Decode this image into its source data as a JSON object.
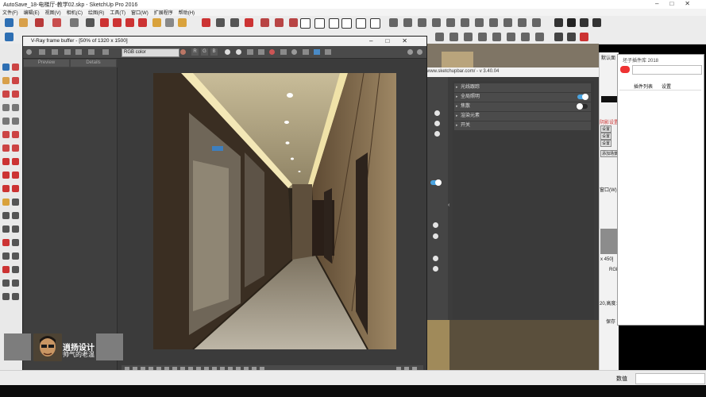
{
  "app": {
    "title": "AutoSave_18-电梯厅-教学02.skp - SketchUp Pro 2016",
    "menu": [
      "文件(F)",
      "编辑(E)",
      "视图(V)",
      "相机(C)",
      "绘图(R)",
      "工具(T)",
      "窗口(W)",
      "扩展程序",
      "帮助(H)"
    ],
    "status_label": "数值"
  },
  "vfb": {
    "title": "V-Ray frame buffer - [50% of 1320 x 1500]",
    "channel": "RGB color",
    "tab_preview": "Preview",
    "tab_details": "Details",
    "channel_letters": [
      "R",
      "G",
      "B"
    ]
  },
  "profile": {
    "name": "逍扬设计",
    "slogan": "帅气的老温"
  },
  "extension": {
    "url": "www.sketchupbar.com/ - v 3.40.04",
    "rows": [
      {
        "label": "光线跟踪",
        "toggle": false
      },
      {
        "label": "全局照明",
        "toggle": true
      },
      {
        "label": "焦散",
        "toggle": false
      },
      {
        "label": "渲染元素",
        "toggle": false
      },
      {
        "label": "开关",
        "toggle": false
      }
    ]
  },
  "plugin": {
    "title": "坯子插件库 2018",
    "tab_list": "插件列表",
    "tab_settings": "设置"
  },
  "tray": {
    "tray_label": "默认面",
    "section_label": "阴影设置",
    "btn_settings_a": "设置",
    "btn_settings_b": "设置",
    "btn_settings_c": "设置",
    "btn_add": "添加场景",
    "window_label": "窗口(W)",
    "size_text": "x 450]",
    "rgb": "RGB",
    "dims": "20,高度:108",
    "keep": "保存"
  },
  "colors": {
    "accent_toggle": "#4aa3df",
    "vfb_bg": "#3b3b3b",
    "chrome": "#ececec"
  }
}
